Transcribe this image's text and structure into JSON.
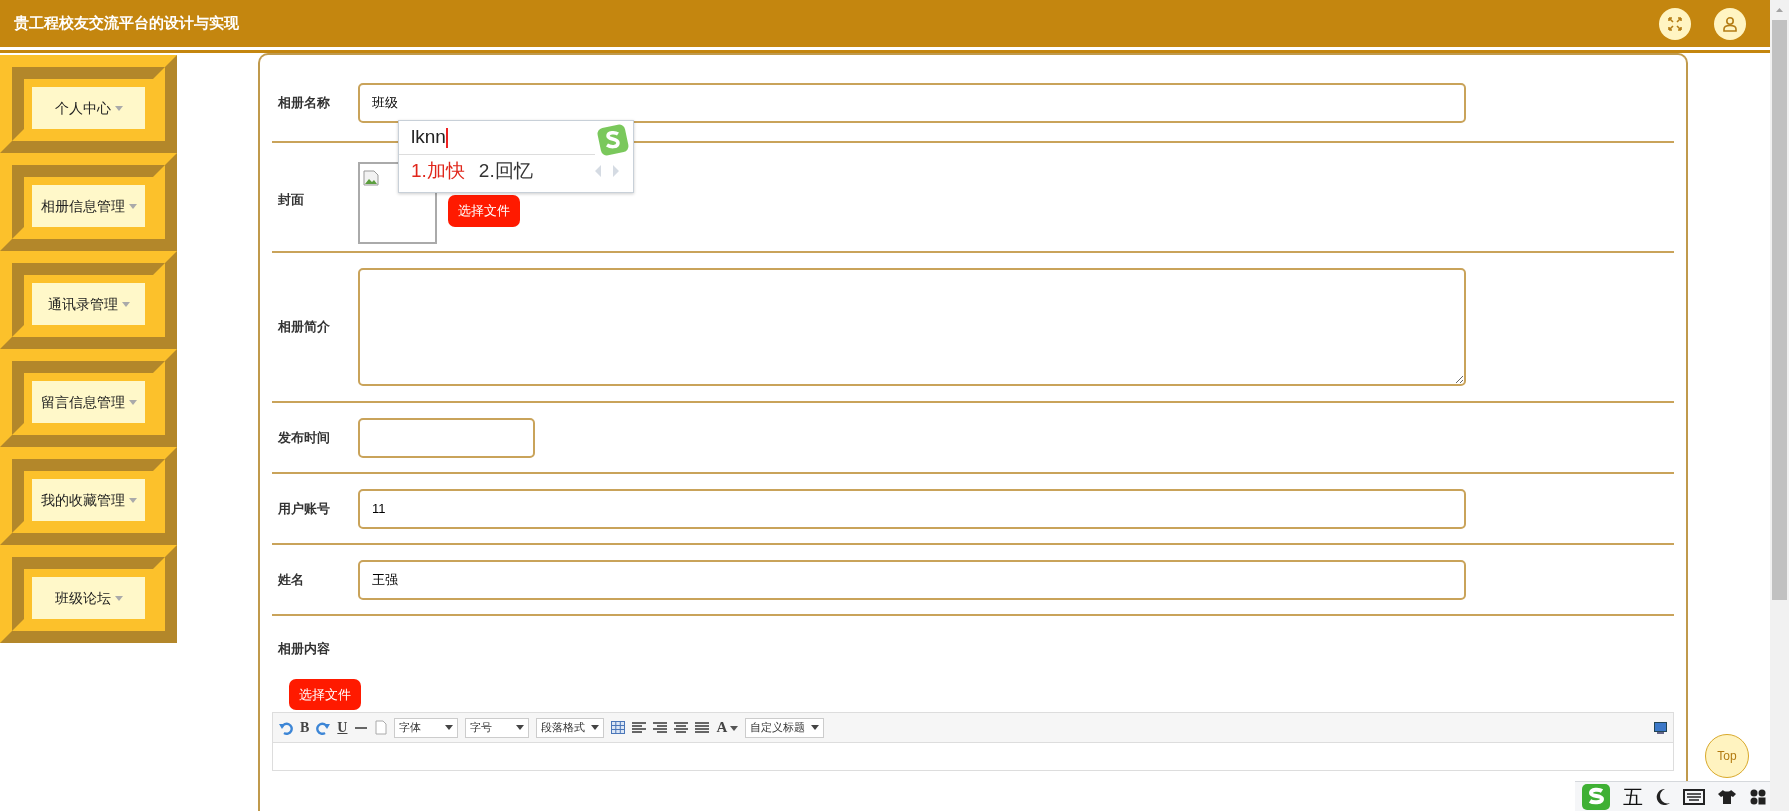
{
  "header": {
    "title": "贵工程校友交流平台的设计与实现"
  },
  "sidebar": {
    "items": [
      {
        "label": "个人中心"
      },
      {
        "label": "相册信息管理"
      },
      {
        "label": "通讯录管理"
      },
      {
        "label": "留言信息管理"
      },
      {
        "label": "我的收藏管理"
      },
      {
        "label": "班级论坛"
      }
    ]
  },
  "form": {
    "fields": [
      {
        "kind": "text",
        "label": "相册名称",
        "value": "班级"
      },
      {
        "kind": "image",
        "label": "封面",
        "button": "选择文件"
      },
      {
        "kind": "textarea",
        "label": "相册简介"
      },
      {
        "kind": "date",
        "label": "发布时间"
      },
      {
        "kind": "text",
        "label": "用户账号",
        "value": "11"
      },
      {
        "kind": "text",
        "label": "姓名",
        "value": "王强"
      },
      {
        "kind": "editor",
        "label": "相册内容",
        "button": "选择文件",
        "toolbar": [
          {
            "kind": "undo"
          },
          {
            "kind": "letter",
            "text": "B"
          },
          {
            "kind": "redo"
          },
          {
            "kind": "letter",
            "text": "U"
          },
          {
            "kind": "rule"
          },
          {
            "kind": "page"
          },
          {
            "kind": "select",
            "text": "字体"
          },
          {
            "kind": "select",
            "text": "字号"
          },
          {
            "kind": "select",
            "text": "段落格式"
          },
          {
            "kind": "table"
          },
          {
            "kind": "align-left"
          },
          {
            "kind": "align-right"
          },
          {
            "kind": "align-center"
          },
          {
            "kind": "justify"
          },
          {
            "kind": "letter-menu",
            "text": "A"
          },
          {
            "kind": "select",
            "text": "自定义标题"
          }
        ]
      }
    ]
  },
  "ime": {
    "composition": "lknn",
    "candidates": [
      {
        "text": "1.加快",
        "selected": true
      },
      {
        "text": "2.回忆",
        "selected": false
      }
    ]
  },
  "ime_bar": {
    "mode": "五"
  },
  "back_to_top": "Top"
}
